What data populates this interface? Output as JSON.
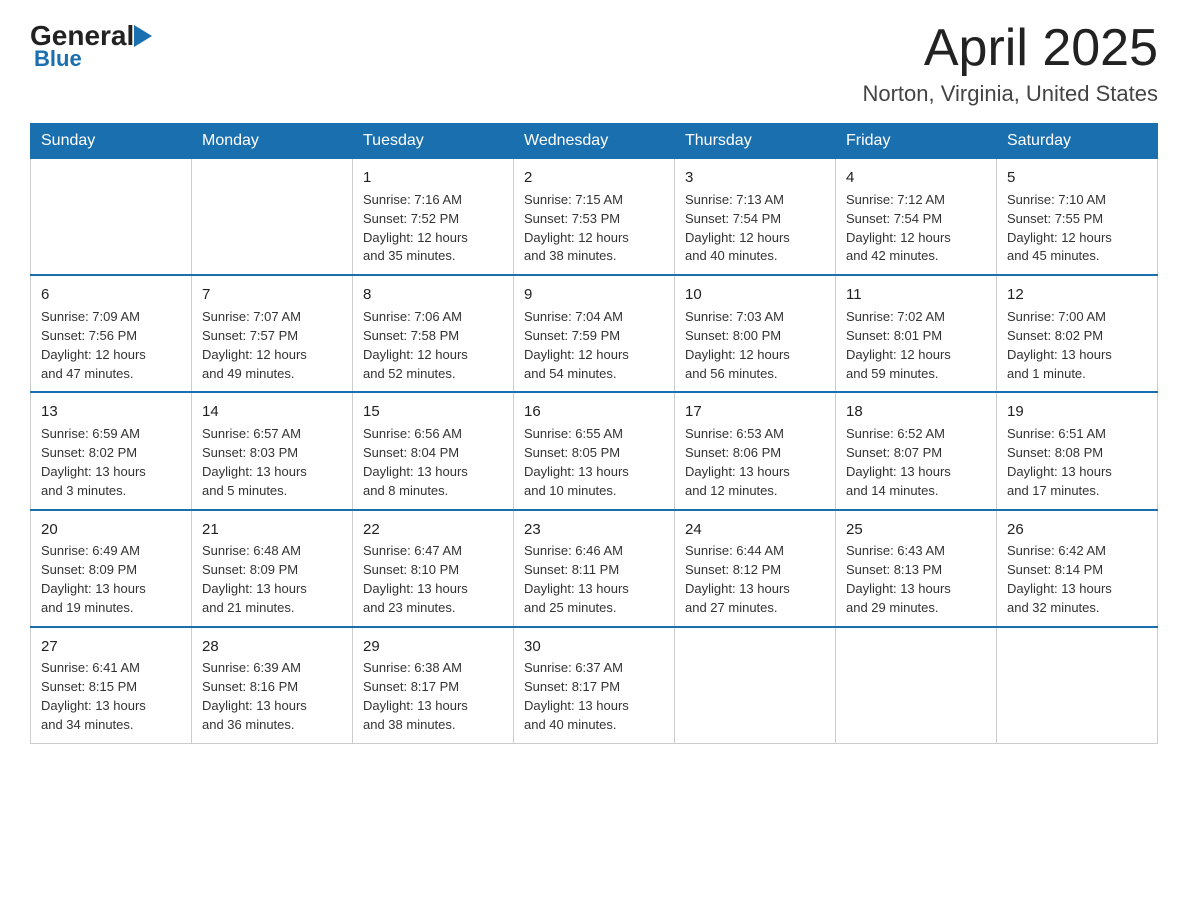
{
  "header": {
    "logo_text_black": "General",
    "logo_text_blue": "Blue",
    "month_title": "April 2025",
    "location": "Norton, Virginia, United States"
  },
  "days_of_week": [
    "Sunday",
    "Monday",
    "Tuesday",
    "Wednesday",
    "Thursday",
    "Friday",
    "Saturday"
  ],
  "weeks": [
    [
      {
        "day": "",
        "info": ""
      },
      {
        "day": "",
        "info": ""
      },
      {
        "day": "1",
        "info": "Sunrise: 7:16 AM\nSunset: 7:52 PM\nDaylight: 12 hours\nand 35 minutes."
      },
      {
        "day": "2",
        "info": "Sunrise: 7:15 AM\nSunset: 7:53 PM\nDaylight: 12 hours\nand 38 minutes."
      },
      {
        "day": "3",
        "info": "Sunrise: 7:13 AM\nSunset: 7:54 PM\nDaylight: 12 hours\nand 40 minutes."
      },
      {
        "day": "4",
        "info": "Sunrise: 7:12 AM\nSunset: 7:54 PM\nDaylight: 12 hours\nand 42 minutes."
      },
      {
        "day": "5",
        "info": "Sunrise: 7:10 AM\nSunset: 7:55 PM\nDaylight: 12 hours\nand 45 minutes."
      }
    ],
    [
      {
        "day": "6",
        "info": "Sunrise: 7:09 AM\nSunset: 7:56 PM\nDaylight: 12 hours\nand 47 minutes."
      },
      {
        "day": "7",
        "info": "Sunrise: 7:07 AM\nSunset: 7:57 PM\nDaylight: 12 hours\nand 49 minutes."
      },
      {
        "day": "8",
        "info": "Sunrise: 7:06 AM\nSunset: 7:58 PM\nDaylight: 12 hours\nand 52 minutes."
      },
      {
        "day": "9",
        "info": "Sunrise: 7:04 AM\nSunset: 7:59 PM\nDaylight: 12 hours\nand 54 minutes."
      },
      {
        "day": "10",
        "info": "Sunrise: 7:03 AM\nSunset: 8:00 PM\nDaylight: 12 hours\nand 56 minutes."
      },
      {
        "day": "11",
        "info": "Sunrise: 7:02 AM\nSunset: 8:01 PM\nDaylight: 12 hours\nand 59 minutes."
      },
      {
        "day": "12",
        "info": "Sunrise: 7:00 AM\nSunset: 8:02 PM\nDaylight: 13 hours\nand 1 minute."
      }
    ],
    [
      {
        "day": "13",
        "info": "Sunrise: 6:59 AM\nSunset: 8:02 PM\nDaylight: 13 hours\nand 3 minutes."
      },
      {
        "day": "14",
        "info": "Sunrise: 6:57 AM\nSunset: 8:03 PM\nDaylight: 13 hours\nand 5 minutes."
      },
      {
        "day": "15",
        "info": "Sunrise: 6:56 AM\nSunset: 8:04 PM\nDaylight: 13 hours\nand 8 minutes."
      },
      {
        "day": "16",
        "info": "Sunrise: 6:55 AM\nSunset: 8:05 PM\nDaylight: 13 hours\nand 10 minutes."
      },
      {
        "day": "17",
        "info": "Sunrise: 6:53 AM\nSunset: 8:06 PM\nDaylight: 13 hours\nand 12 minutes."
      },
      {
        "day": "18",
        "info": "Sunrise: 6:52 AM\nSunset: 8:07 PM\nDaylight: 13 hours\nand 14 minutes."
      },
      {
        "day": "19",
        "info": "Sunrise: 6:51 AM\nSunset: 8:08 PM\nDaylight: 13 hours\nand 17 minutes."
      }
    ],
    [
      {
        "day": "20",
        "info": "Sunrise: 6:49 AM\nSunset: 8:09 PM\nDaylight: 13 hours\nand 19 minutes."
      },
      {
        "day": "21",
        "info": "Sunrise: 6:48 AM\nSunset: 8:09 PM\nDaylight: 13 hours\nand 21 minutes."
      },
      {
        "day": "22",
        "info": "Sunrise: 6:47 AM\nSunset: 8:10 PM\nDaylight: 13 hours\nand 23 minutes."
      },
      {
        "day": "23",
        "info": "Sunrise: 6:46 AM\nSunset: 8:11 PM\nDaylight: 13 hours\nand 25 minutes."
      },
      {
        "day": "24",
        "info": "Sunrise: 6:44 AM\nSunset: 8:12 PM\nDaylight: 13 hours\nand 27 minutes."
      },
      {
        "day": "25",
        "info": "Sunrise: 6:43 AM\nSunset: 8:13 PM\nDaylight: 13 hours\nand 29 minutes."
      },
      {
        "day": "26",
        "info": "Sunrise: 6:42 AM\nSunset: 8:14 PM\nDaylight: 13 hours\nand 32 minutes."
      }
    ],
    [
      {
        "day": "27",
        "info": "Sunrise: 6:41 AM\nSunset: 8:15 PM\nDaylight: 13 hours\nand 34 minutes."
      },
      {
        "day": "28",
        "info": "Sunrise: 6:39 AM\nSunset: 8:16 PM\nDaylight: 13 hours\nand 36 minutes."
      },
      {
        "day": "29",
        "info": "Sunrise: 6:38 AM\nSunset: 8:17 PM\nDaylight: 13 hours\nand 38 minutes."
      },
      {
        "day": "30",
        "info": "Sunrise: 6:37 AM\nSunset: 8:17 PM\nDaylight: 13 hours\nand 40 minutes."
      },
      {
        "day": "",
        "info": ""
      },
      {
        "day": "",
        "info": ""
      },
      {
        "day": "",
        "info": ""
      }
    ]
  ]
}
